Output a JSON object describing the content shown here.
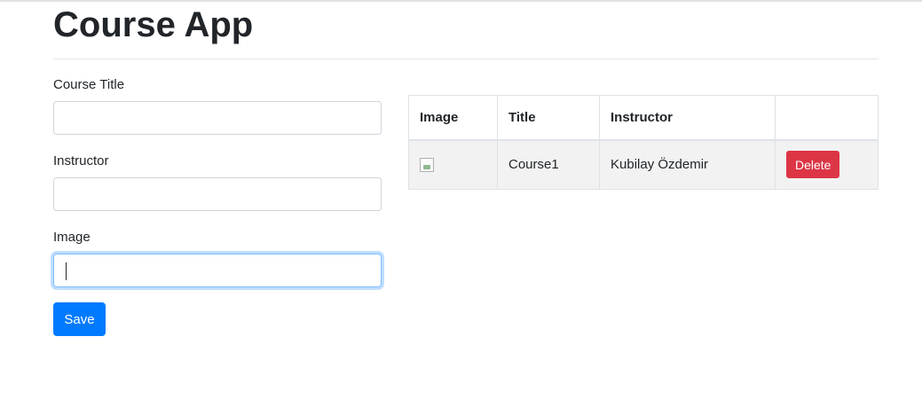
{
  "app": {
    "title": "Course App"
  },
  "form": {
    "fields": [
      {
        "label": "Course Title",
        "value": ""
      },
      {
        "label": "Instructor",
        "value": ""
      },
      {
        "label": "Image",
        "value": ""
      }
    ],
    "save_label": "Save"
  },
  "table": {
    "headers": [
      "Image",
      "Title",
      "Instructor",
      ""
    ],
    "rows": [
      {
        "image": "",
        "title": "Course1",
        "instructor": "Kubilay Özdemir",
        "action_label": "Delete"
      }
    ]
  },
  "colors": {
    "primary": "#007bff",
    "danger": "#dc3545",
    "row_bg": "#f2f2f2",
    "focus_border": "#80bdff"
  }
}
